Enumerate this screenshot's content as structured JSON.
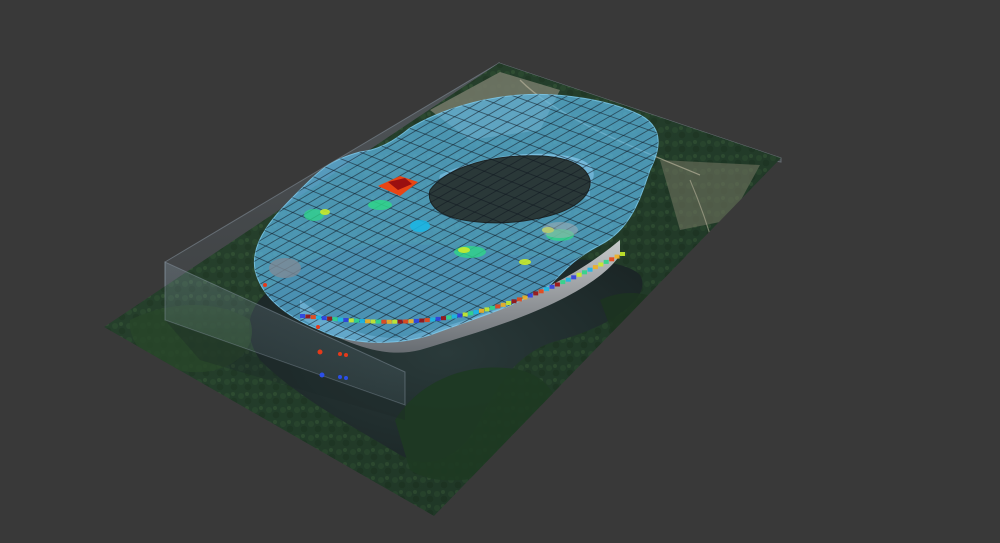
{
  "scene": {
    "background_color": "#393939",
    "terrain_colors": {
      "forest_dark": "#1c3320",
      "forest_mid": "#2c4a2c",
      "water": "#1f2b2c",
      "urban": "#8f8f84"
    },
    "volume_colors": {
      "shell": "#5cb8e6",
      "grid": "#101820",
      "wall": "#c9cbce",
      "wall_shade": "#7d8187"
    },
    "colormap": [
      "#2d3fe0",
      "#19b7e6",
      "#2fd68a",
      "#c9ec2a",
      "#f2b020",
      "#e84514",
      "#9a1010"
    ],
    "markers": [
      {
        "color": "#e53a1a"
      },
      {
        "color": "#2b4fe8"
      }
    ]
  }
}
